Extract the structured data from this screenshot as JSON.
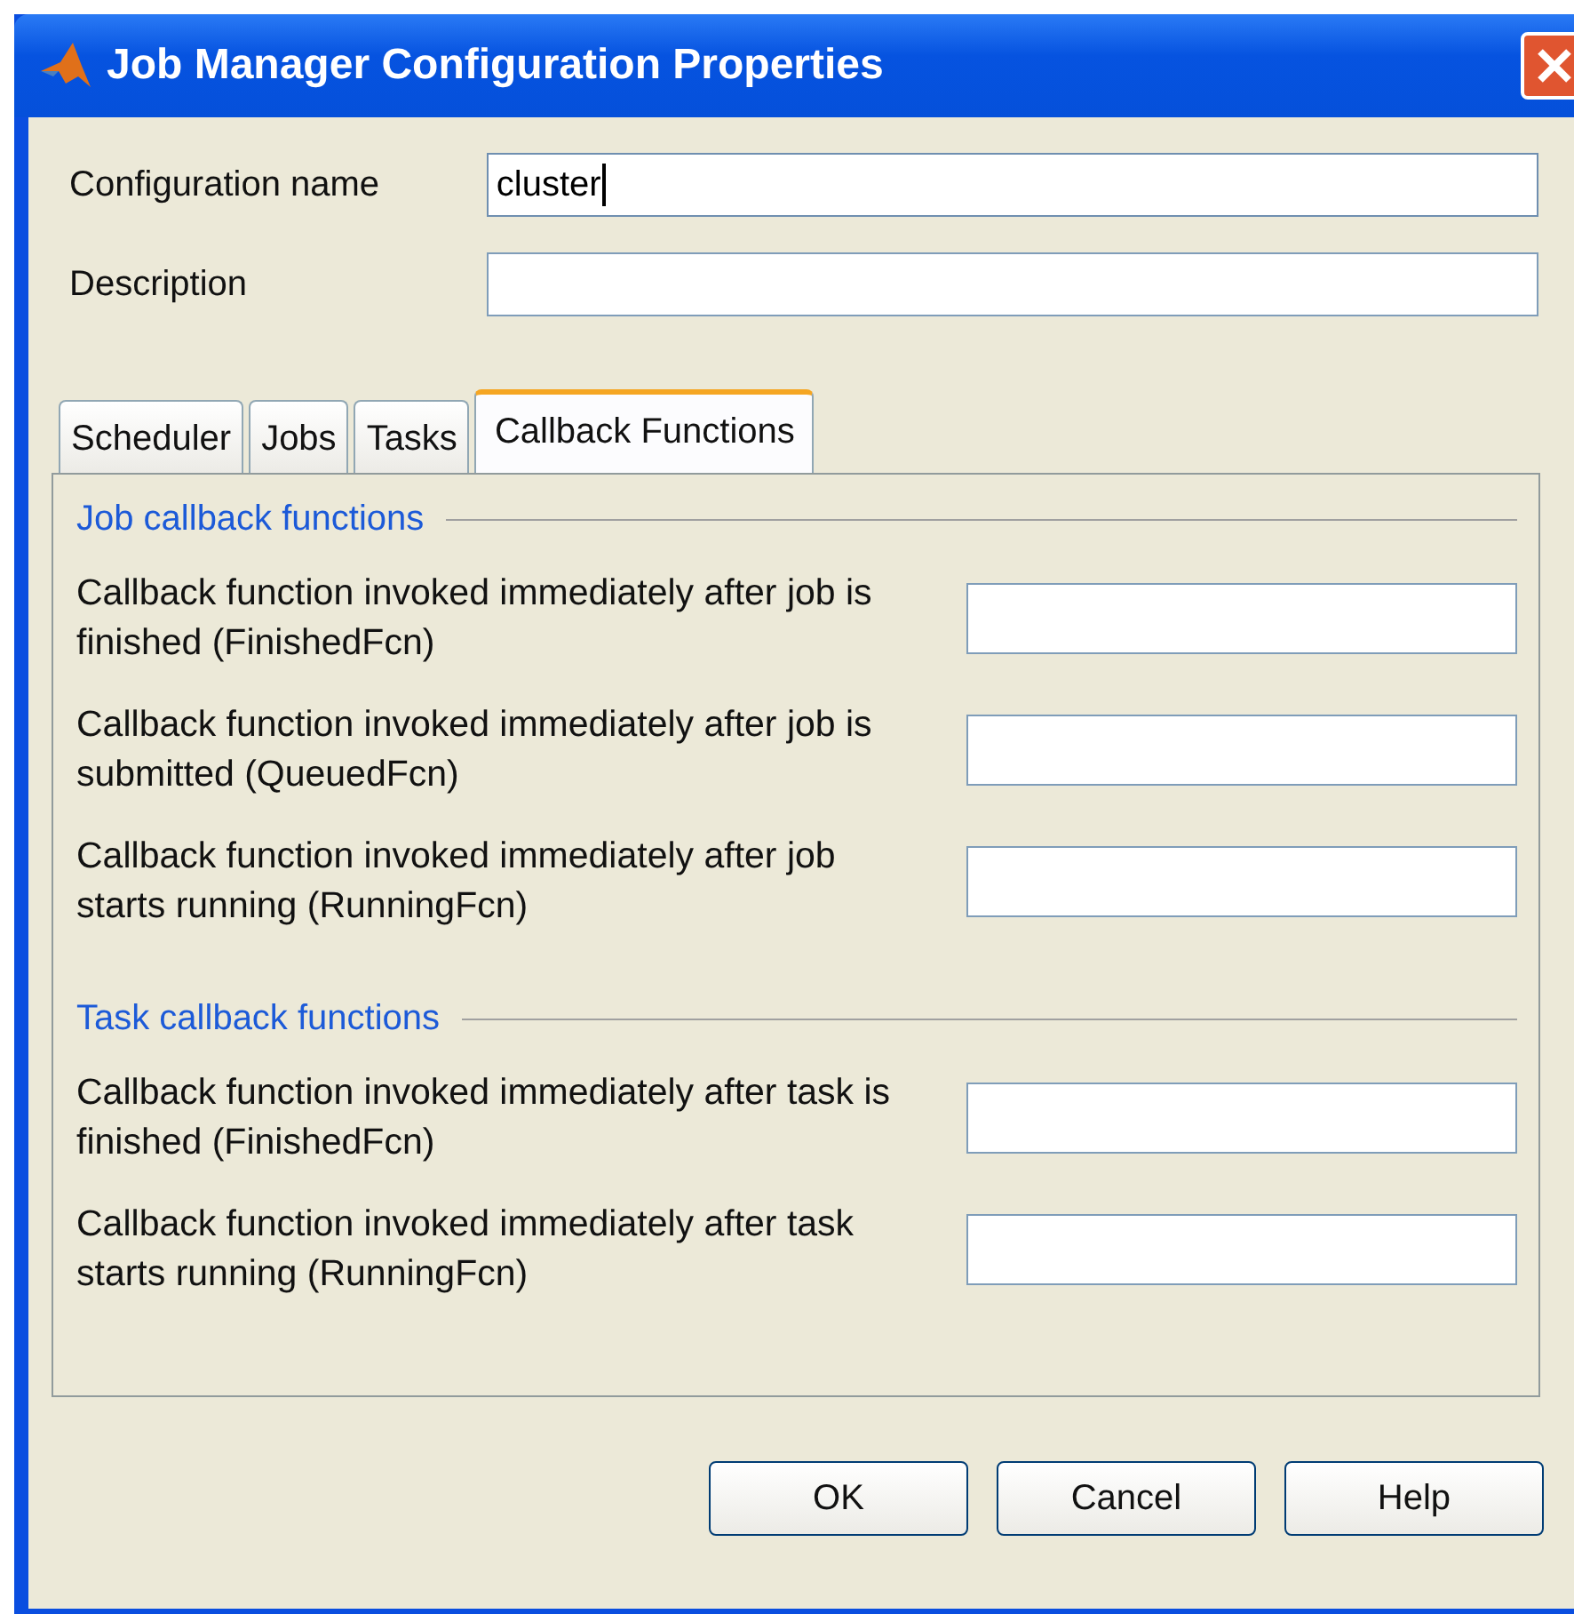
{
  "window": {
    "title": "Job Manager Configuration Properties"
  },
  "fields": [
    {
      "label": "Configuration name",
      "value": "cluster",
      "focused": true
    },
    {
      "label": "Description",
      "focused": false
    }
  ],
  "tabs": [
    {
      "label": "Scheduler",
      "selected": false
    },
    {
      "label": "Jobs",
      "selected": false
    },
    {
      "label": "Tasks",
      "selected": false
    },
    {
      "label": "Callback Functions",
      "selected": true
    }
  ],
  "sections": [
    {
      "title": "Job callback functions",
      "rows": [
        {
          "label": "Callback function invoked immediately after job is finished (FinishedFcn)"
        },
        {
          "label": "Callback function invoked immediately after job is submitted (QueuedFcn)"
        },
        {
          "label": "Callback function invoked immediately after job starts running (RunningFcn)"
        }
      ]
    },
    {
      "title": "Task callback functions",
      "rows": [
        {
          "label": "Callback function invoked immediately after task is finished (FinishedFcn)"
        },
        {
          "label": "Callback function invoked immediately after task starts running (RunningFcn)"
        }
      ]
    }
  ],
  "buttons": [
    "OK",
    "Cancel",
    "Help"
  ]
}
